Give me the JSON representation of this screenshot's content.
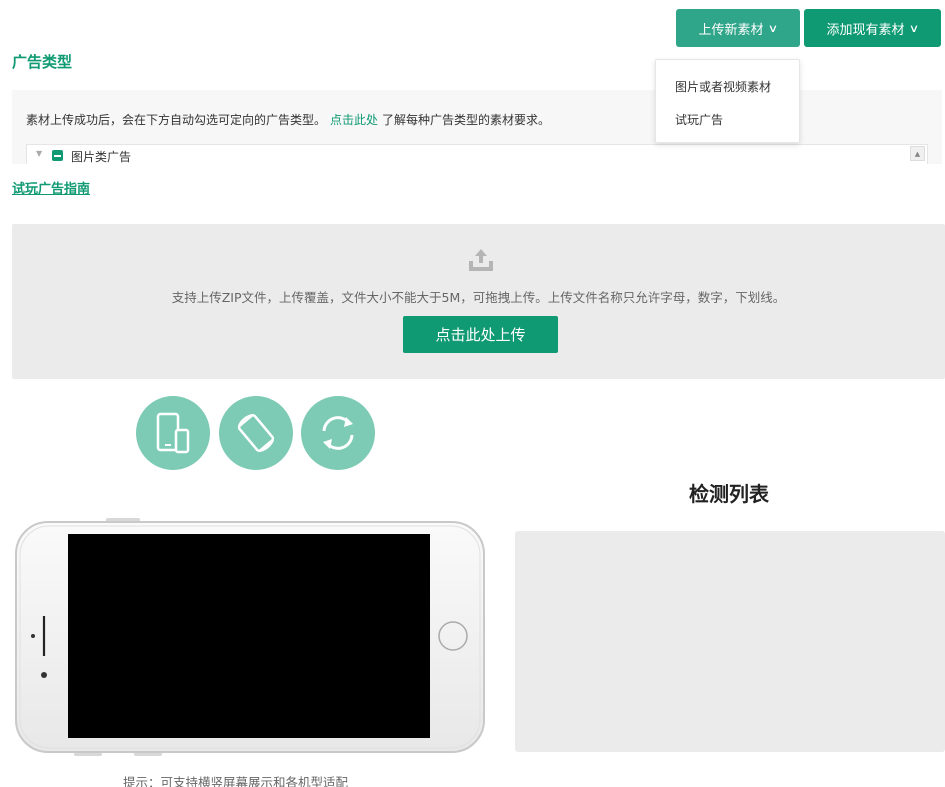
{
  "toolbar": {
    "upload_label": "上传新素材",
    "add_label": "添加现有素材"
  },
  "dropdown": {
    "items": [
      "图片或者视频素材",
      "试玩广告"
    ]
  },
  "ad_type": {
    "title": "广告类型",
    "info_before": "素材上传成功后，会在下方自动勾选可定向的广告类型。",
    "info_link": "点击此处",
    "info_after": "了解每种广告类型的素材要求。",
    "tree_label": "图片类广告"
  },
  "guide_link": "试玩广告指南",
  "upload": {
    "hint": "支持上传ZIP文件，上传覆盖，文件大小不能大于5M，可拖拽上传。上传文件名称只允许字母，数字，下划线。",
    "button": "点击此处上传"
  },
  "preview": {
    "tip": "提示：可支持横竖屏幕展示和各机型适配"
  },
  "check_list": {
    "title": "检测列表"
  },
  "colors": {
    "primary": "#0f9a73",
    "primary_light": "#2fa58a",
    "circle": "#7dcbb4",
    "panel_bg": "#ebebeb"
  }
}
